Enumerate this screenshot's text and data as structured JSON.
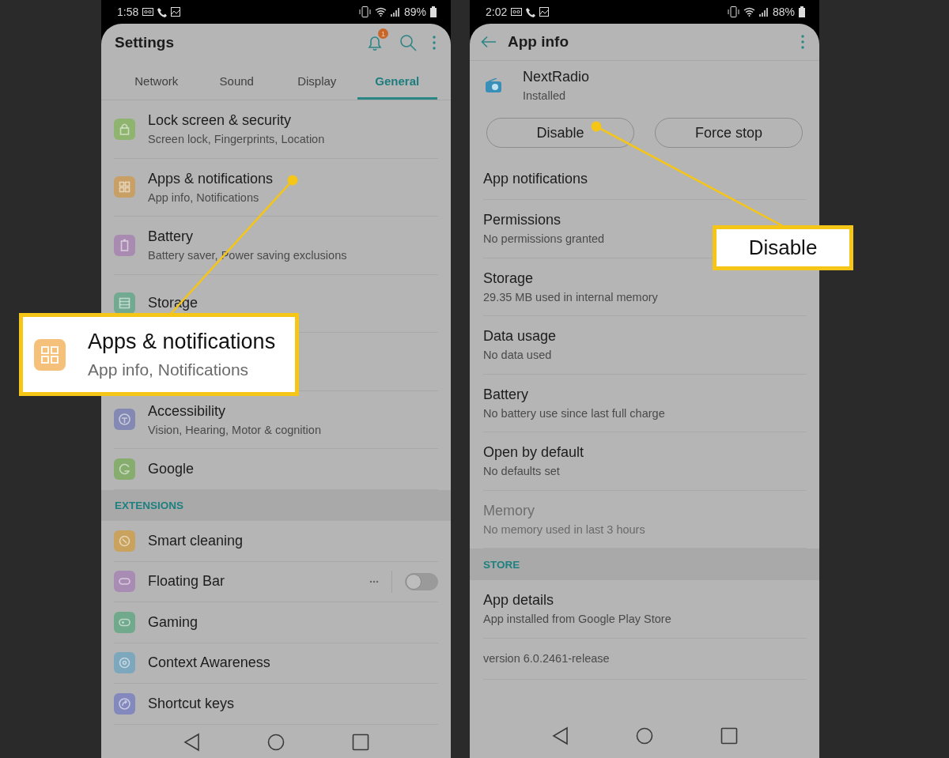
{
  "left_phone": {
    "status_bar": {
      "time": "1:58",
      "battery": "89%"
    },
    "title": "Settings",
    "notification_badge": "1",
    "tabs": [
      {
        "label": "Network",
        "selected": false
      },
      {
        "label": "Sound",
        "selected": false
      },
      {
        "label": "Display",
        "selected": false
      },
      {
        "label": "General",
        "selected": true
      }
    ],
    "items": [
      {
        "kind": "two-line",
        "title": "Lock screen & security",
        "subtitle": "Screen lock, Fingerprints, Location",
        "color": "#8fb46f"
      },
      {
        "kind": "two-line",
        "title": "Apps & notifications",
        "subtitle": "App info, Notifications",
        "color": "#c8a066"
      },
      {
        "kind": "two-line",
        "title": "Battery",
        "subtitle": "Battery saver, Power saving exclusions",
        "color": "#a98bb2"
      },
      {
        "kind": "two-line",
        "title": "Storage",
        "color": "#72a991"
      },
      {
        "kind": "covered"
      },
      {
        "kind": "two-line",
        "title": "Accessibility",
        "subtitle": "Vision, Hearing, Motor & cognition",
        "color": "#8389b3"
      },
      {
        "kind": "one-line",
        "title": "Google",
        "color": "#86ad6e"
      },
      {
        "kind": "header",
        "title": "EXTENSIONS"
      },
      {
        "kind": "one-line",
        "title": "Smart cleaning",
        "color": "#c9a35e"
      },
      {
        "kind": "toggle",
        "title": "Floating Bar",
        "color": "#a98cb3",
        "on": false
      },
      {
        "kind": "one-line",
        "title": "Gaming",
        "color": "#71a98d"
      },
      {
        "kind": "one-line",
        "title": "Context Awareness",
        "color": "#7ca7bd"
      },
      {
        "kind": "one-line",
        "title": "Shortcut keys",
        "color": "#8389bd"
      }
    ]
  },
  "right_phone": {
    "status_bar": {
      "time": "2:02",
      "battery": "88%"
    },
    "title": "App info",
    "app": {
      "name": "NextRadio",
      "status": "Installed"
    },
    "buttons": [
      "Disable",
      "Force stop"
    ],
    "items": [
      {
        "kind": "one-line",
        "title": "App notifications",
        "disabled": false
      },
      {
        "kind": "two-line",
        "title": "Permissions",
        "subtitle": "No permissions granted",
        "disabled": false
      },
      {
        "kind": "two-line",
        "title": "Storage",
        "subtitle": "29.35 MB used in internal memory",
        "disabled": false
      },
      {
        "kind": "two-line",
        "title": "Data usage",
        "subtitle": "No data used",
        "disabled": false
      },
      {
        "kind": "two-line",
        "title": "Battery",
        "subtitle": "No battery use since last full charge",
        "disabled": false
      },
      {
        "kind": "two-line",
        "title": "Open by default",
        "subtitle": "No defaults set",
        "disabled": false
      },
      {
        "kind": "two-line",
        "title": "Memory",
        "subtitle": "No memory used in last 3 hours",
        "disabled": true
      },
      {
        "kind": "header",
        "title": "STORE"
      },
      {
        "kind": "two-line",
        "title": "App details",
        "subtitle": "App installed from Google Play Store",
        "disabled": false
      },
      {
        "kind": "one-line",
        "title": "version 6.0.2461-release",
        "disabled": false
      }
    ]
  },
  "callouts": [
    {
      "title": "Apps & notifications",
      "subtitle": "App info, Notifications",
      "color": "#f5c07a"
    },
    {
      "title": "Disable"
    }
  ]
}
